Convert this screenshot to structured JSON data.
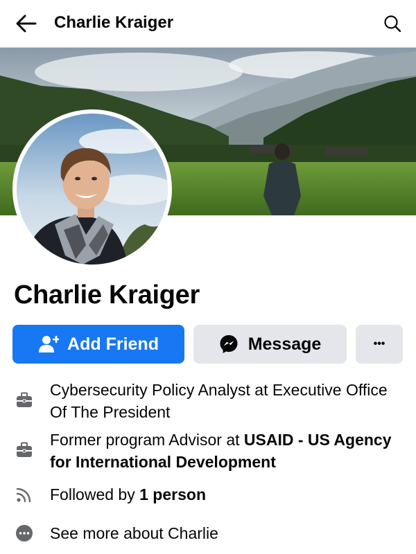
{
  "header": {
    "title": "Charlie Kraiger",
    "back_icon": "arrow-left-icon",
    "search_icon": "search-icon"
  },
  "profile": {
    "name": "Charlie Kraiger"
  },
  "actions": {
    "add_friend_label": "Add Friend",
    "message_label": "Message",
    "more_label": "•••"
  },
  "about": {
    "job_current": "Cybersecurity Policy Analyst at Executive Office Of The President",
    "job_former_prefix": "Former program Advisor at ",
    "job_former_org": "USAID - US Agency for International Development",
    "followed_prefix": "Followed by ",
    "followed_count": "1 person",
    "see_more": "See more about Charlie"
  },
  "colors": {
    "primary": "#1877f2",
    "secondary_button": "#e4e6eb",
    "text": "#050505",
    "icon": "#65676b"
  }
}
